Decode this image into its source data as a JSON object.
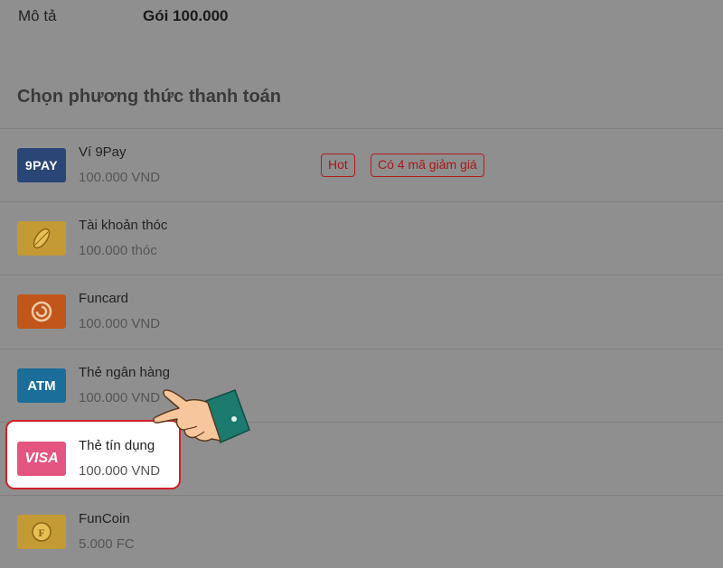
{
  "description": {
    "label": "Mô tả",
    "value": "Gói 100.000"
  },
  "section_title": "Chọn phương thức thanh toán",
  "payment_methods": [
    {
      "name": "Ví 9Pay",
      "amount": "100.000 VND",
      "logo_text": "9PAY",
      "logo_icon": "9pay-logo-icon",
      "color": "#2a4677",
      "tags": [
        "Hot",
        "Có 4 mã giảm giá"
      ]
    },
    {
      "name": "Tài khoản thóc",
      "amount": "100.000 thóc",
      "logo_text": "",
      "logo_icon": "rice-grain-icon",
      "color": "#c49a34"
    },
    {
      "name": "Funcard",
      "amount": "100.000 VND",
      "logo_text": "",
      "logo_icon": "funcard-swirl-icon",
      "color": "#c0561a"
    },
    {
      "name": "Thẻ ngân hàng",
      "amount": "100.000 VND",
      "logo_text": "ATM",
      "logo_icon": "atm-icon",
      "color": "#1b6d9a"
    },
    {
      "name": "Thẻ tín dụng",
      "amount": "100.000 VND",
      "logo_text": "VISA",
      "logo_icon": "visa-icon",
      "color": "#e3557f",
      "highlighted": true
    },
    {
      "name": "FunCoin",
      "amount": "5.000 FC",
      "logo_text": "",
      "logo_icon": "funcoin-icon",
      "color": "#c49a34"
    }
  ],
  "accent_color": "#d0202a"
}
